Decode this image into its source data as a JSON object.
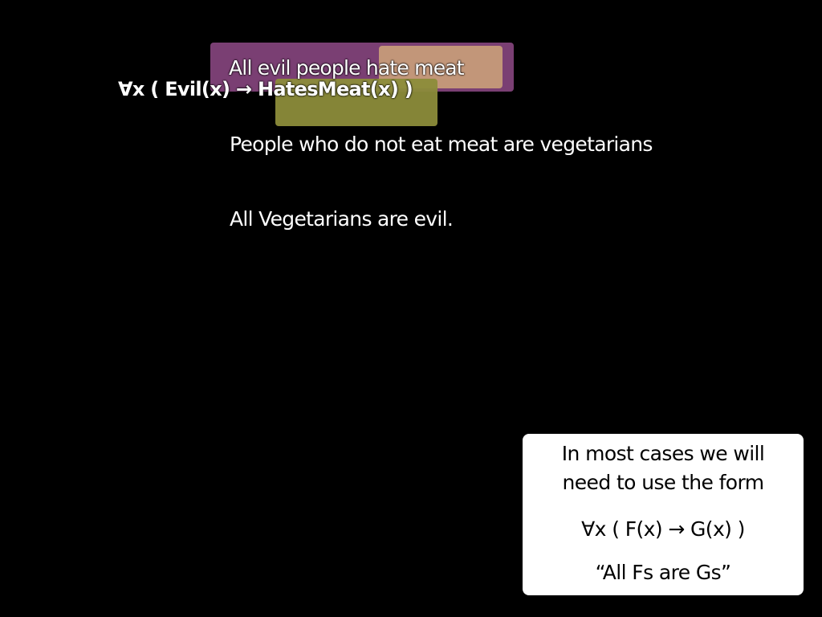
{
  "slide": {
    "caption": "All evil people hate meat",
    "formula": "∀x ( Evil(x) → HatesMeat(x) )",
    "sentences": [
      "People who do not eat meat are vegetarians",
      "All Vegetarians are evil."
    ],
    "info_box": {
      "line1": "In most cases we will",
      "line2": "need to use the form",
      "formula": "∀x ( F(x) → G(x) )",
      "quote": "“All Fs are Gs”"
    }
  },
  "colors": {
    "background": "#000000",
    "text": "#ffffff",
    "highlight_purple": "#7a3f73",
    "highlight_peach": "#c89d7a",
    "highlight_olive": "#8c8c3a",
    "box_background": "#ffffff",
    "box_text": "#000000"
  }
}
